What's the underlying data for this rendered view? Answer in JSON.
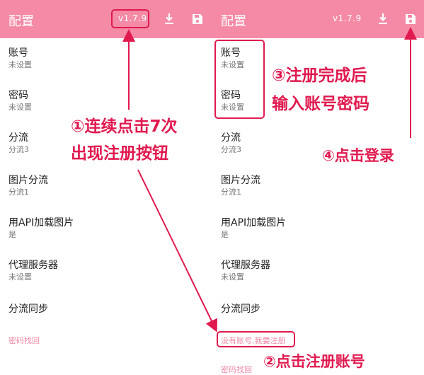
{
  "left_screen": {
    "title": "配置",
    "version": "v1.7.9",
    "settings": [
      {
        "label": "账号",
        "value": "未设置"
      },
      {
        "label": "密码",
        "value": "未设置"
      },
      {
        "label": "分流",
        "value": "分流3"
      },
      {
        "label": "图片分流",
        "value": "分流1"
      },
      {
        "label": "用API加载图片",
        "value": "是"
      },
      {
        "label": "代理服务器",
        "value": "未设置"
      },
      {
        "label": "分流同步",
        "value": ""
      }
    ],
    "recover_link": "密码找回"
  },
  "right_screen": {
    "title": "配置",
    "version": "v1.7.9",
    "settings": [
      {
        "label": "账号",
        "value": "未设置"
      },
      {
        "label": "密码",
        "value": "未设置"
      },
      {
        "label": "分流",
        "value": "分流3"
      },
      {
        "label": "图片分流",
        "value": "分流1"
      },
      {
        "label": "用API加载图片",
        "value": "是"
      },
      {
        "label": "代理服务器",
        "value": "未设置"
      },
      {
        "label": "分流同步",
        "value": ""
      }
    ],
    "register_link": "没有账号,我要注册",
    "recover_link": "密码找回"
  },
  "annotations": {
    "step1_line1": "①连续点击7次",
    "step1_line2": "出现注册按钮",
    "step2": "②点击注册账号",
    "step3_line1": "③注册完成后",
    "step3_line2": "输入账号密码",
    "step4": "④点击登录"
  },
  "colors": {
    "appbar": "#f48aa6",
    "annotation": "#e01a4f",
    "link": "#f08aa8"
  },
  "icons": [
    "download-icon",
    "save-icon"
  ]
}
